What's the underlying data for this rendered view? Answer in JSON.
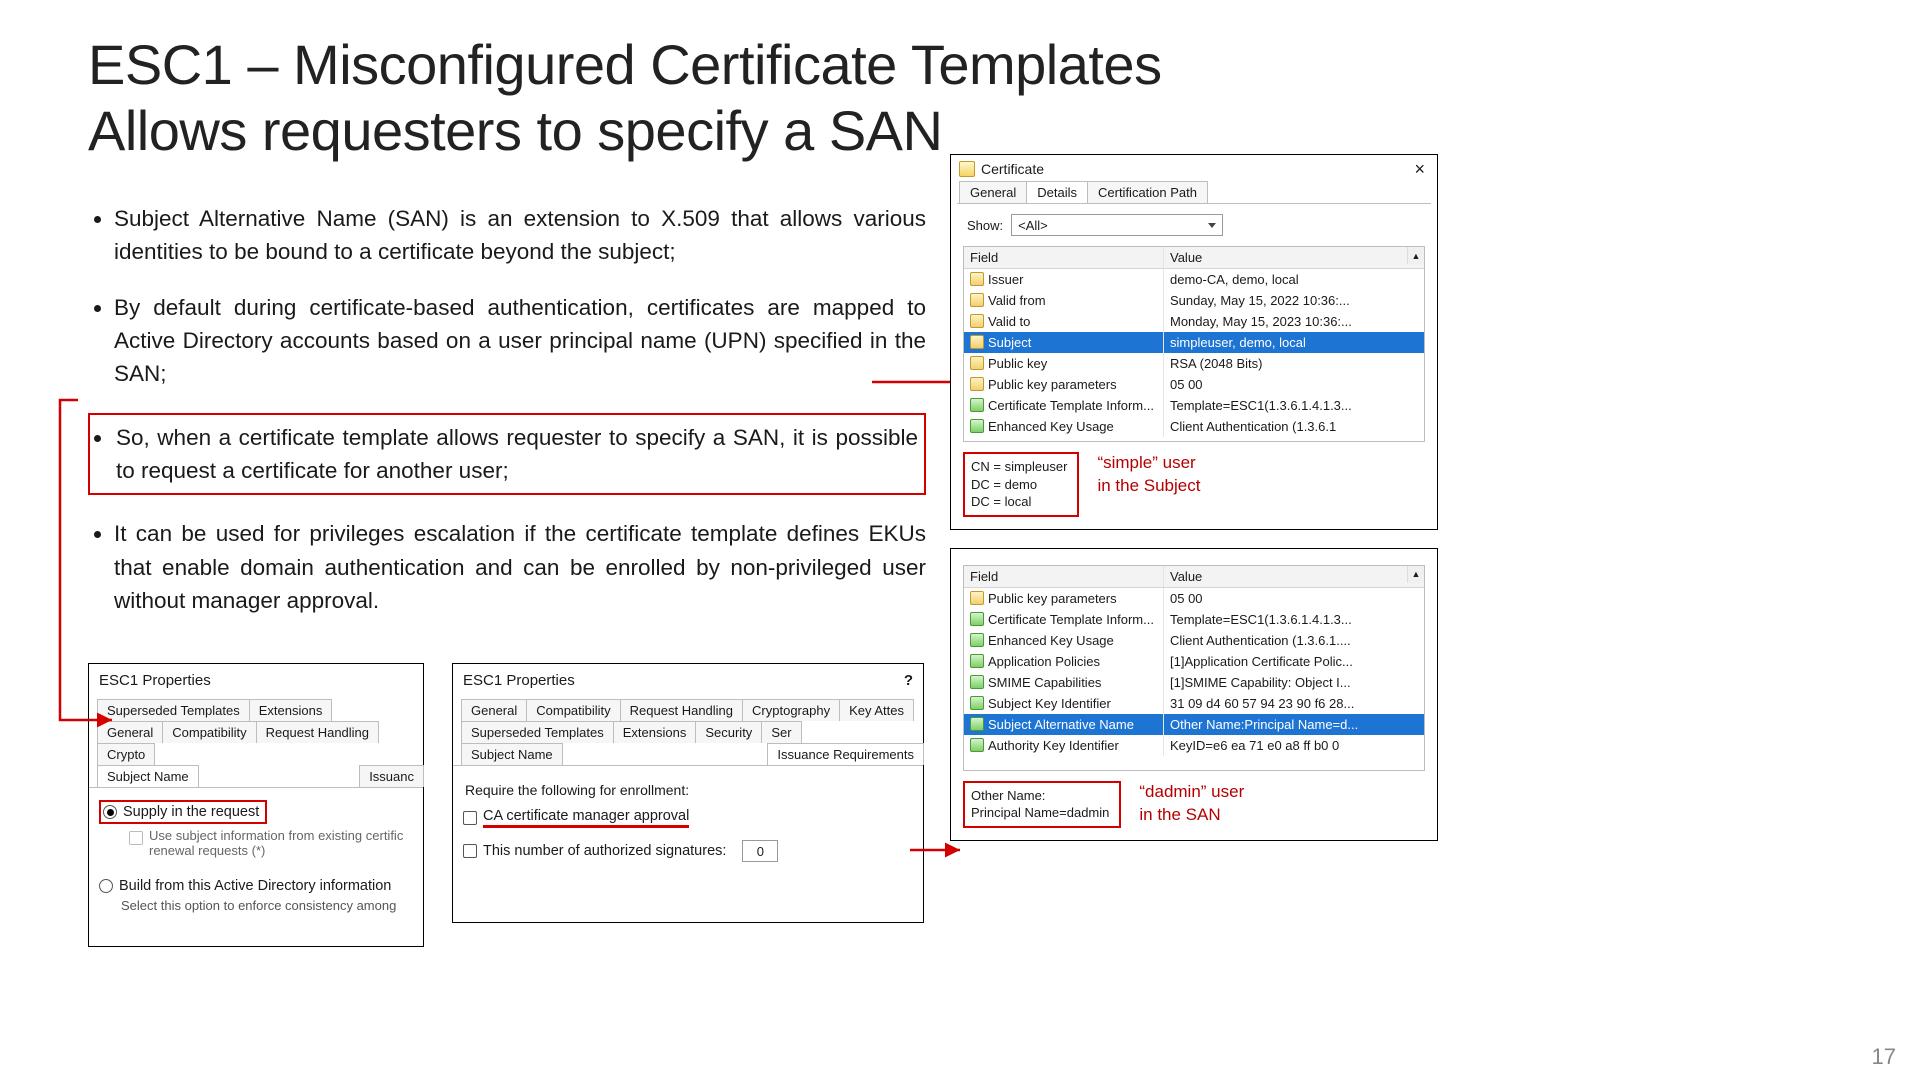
{
  "title_line1": "ESC1 – Misconfigured Certificate Templates",
  "title_line2": "Allows requesters to specify a SAN",
  "bullets": {
    "b1": "Subject Alternative Name (SAN) is an extension to X.509 that allows various identities to be bound to a certificate beyond the subject;",
    "b2": "By default during certificate-based authentication, certificates are mapped to Active Directory accounts based on a user principal name (UPN) specified in the SAN;",
    "b3": "So, when a certificate template allows requester to specify a SAN, it is possible to request a certificate for another user;",
    "b4": "It can be used for privileges escalation if the certificate template defines EKUs that enable domain authentication and can be enrolled by non-privileged user without manager approval."
  },
  "props_panel_a": {
    "title": "ESC1 Properties",
    "tabs_row1": [
      "Superseded Templates",
      "Extensions"
    ],
    "tabs_row2": [
      "General",
      "Compatibility",
      "Request Handling",
      "Crypto"
    ],
    "tabs_row3": [
      "Subject Name",
      "Issuanc"
    ],
    "radio_supply": "Supply in the request",
    "sub_check": "Use subject information from existing certific renewal requests (*)",
    "radio_build": "Build from this Active Directory information",
    "hint": "Select this option to enforce consistency among"
  },
  "props_panel_b": {
    "title": "ESC1 Properties",
    "qmark": "?",
    "tabs_row1": [
      "General",
      "Compatibility",
      "Request Handling",
      "Cryptography",
      "Key Attes"
    ],
    "tabs_row2": [
      "Superseded Templates",
      "Extensions",
      "Security",
      "Ser"
    ],
    "tabs_row3": [
      "Subject Name",
      "Issuance Requirements"
    ],
    "req_label": "Require the following for enrollment:",
    "check_ca": "CA certificate manager approval",
    "check_sigs": "This number of authorized signatures:",
    "sigs_value": "0"
  },
  "cert_window": {
    "title": "Certificate",
    "tabs": [
      "General",
      "Details",
      "Certification Path"
    ],
    "show_label": "Show:",
    "show_value": "<All>",
    "cols": {
      "field": "Field",
      "value": "Value"
    },
    "rows_top": [
      {
        "field": "Issuer",
        "value": "demo-CA, demo, local",
        "icon": "y"
      },
      {
        "field": "Valid from",
        "value": "Sunday, May 15, 2022 10:36:...",
        "icon": "y"
      },
      {
        "field": "Valid to",
        "value": "Monday, May 15, 2023 10:36:...",
        "icon": "y"
      },
      {
        "field": "Subject",
        "value": "simpleuser, demo, local",
        "icon": "y",
        "selected": true
      },
      {
        "field": "Public key",
        "value": "RSA (2048 Bits)",
        "icon": "y"
      },
      {
        "field": "Public key parameters",
        "value": "05 00",
        "icon": "y"
      },
      {
        "field": "Certificate Template Inform...",
        "value": "Template=ESC1(1.3.6.1.4.1.3...",
        "icon": "g"
      },
      {
        "field": "Enhanced Key Usage",
        "value": "Client Authentication (1.3.6.1",
        "icon": "g"
      }
    ],
    "subject_detail": "CN = simpleuser\nDC = demo\nDC = local",
    "subject_note_l1": "“simple” user",
    "subject_note_l2": "in the Subject",
    "rows_bottom": [
      {
        "field": "Public key parameters",
        "value": "05 00",
        "icon": "y"
      },
      {
        "field": "Certificate Template Inform...",
        "value": "Template=ESC1(1.3.6.1.4.1.3...",
        "icon": "g"
      },
      {
        "field": "Enhanced Key Usage",
        "value": "Client Authentication (1.3.6.1....",
        "icon": "g"
      },
      {
        "field": "Application Policies",
        "value": "[1]Application Certificate Polic...",
        "icon": "g"
      },
      {
        "field": "SMIME Capabilities",
        "value": "[1]SMIME Capability: Object I...",
        "icon": "g"
      },
      {
        "field": "Subject Key Identifier",
        "value": "31 09 d4 60 57 94 23 90 f6 28...",
        "icon": "g"
      },
      {
        "field": "Subject Alternative Name",
        "value": "Other Name:Principal Name=d...",
        "icon": "g",
        "selected": true
      },
      {
        "field": "Authority Key Identifier",
        "value": "KeyID=e6 ea 71 e0 a8 ff b0 0",
        "icon": "g"
      }
    ],
    "san_detail": "Other Name:\n    Principal Name=dadmin",
    "san_note_l1": "“dadmin” user",
    "san_note_l2": "in the SAN"
  },
  "page_number": "17"
}
